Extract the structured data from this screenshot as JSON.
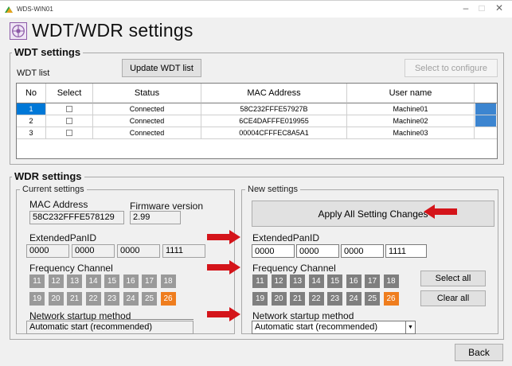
{
  "window": {
    "title": "WDS-WIN01",
    "controls": [
      "–",
      "□",
      "✕"
    ]
  },
  "header": {
    "title": "WDT/WDR settings",
    "icon": "network-settings-icon"
  },
  "wdt": {
    "group_label": "WDT settings",
    "list_label": "WDT list",
    "update_button": "Update WDT list",
    "select_button": "Select to configure",
    "columns": [
      "No",
      "Select",
      "Status",
      "MAC Address",
      "User name"
    ],
    "rows": [
      {
        "no": "1",
        "status": "Connected",
        "mac": "58C232FFFE57927B",
        "user": "Machine01",
        "selected": true
      },
      {
        "no": "2",
        "status": "Connected",
        "mac": "6CE4DAFFFE019955",
        "user": "Machine02",
        "selected": false
      },
      {
        "no": "3",
        "status": "Connected",
        "mac": "00004CFFFEC8A5A1",
        "user": "Machine03",
        "selected": false
      }
    ]
  },
  "wdr": {
    "group_label": "WDR settings",
    "current": {
      "label": "Current settings",
      "mac_label": "MAC Address",
      "mac_value": "58C232FFFE578129",
      "fw_label": "Firmware version",
      "fw_value": "2.99",
      "pan_label": "ExtendedPanID",
      "pan_values": [
        "0000",
        "0000",
        "0000",
        "1111"
      ],
      "freq_label": "Frequency Channel",
      "channels": [
        "11",
        "12",
        "13",
        "14",
        "15",
        "16",
        "17",
        "18",
        "19",
        "20",
        "21",
        "22",
        "23",
        "24",
        "25",
        "26"
      ],
      "highlight_channel": "26",
      "startup_label": "Network startup method",
      "startup_value": "Automatic start (recommended)"
    },
    "new": {
      "label": "New settings",
      "apply_button": "Apply All Setting Changes",
      "pan_label": "ExtendedPanID",
      "pan_values": [
        "0000",
        "0000",
        "0000",
        "1111"
      ],
      "freq_label": "Frequency Channel",
      "channels": [
        "11",
        "12",
        "13",
        "14",
        "15",
        "16",
        "17",
        "18",
        "19",
        "20",
        "21",
        "22",
        "23",
        "24",
        "25",
        "26"
      ],
      "highlight_channel": "26",
      "select_all_button": "Select all",
      "clear_all_button": "Clear all",
      "startup_label": "Network startup method",
      "startup_value": "Automatic start (recommended)"
    }
  },
  "footer": {
    "back_button": "Back"
  },
  "colors": {
    "selected_row": "#0078d7",
    "highlight_channel": "#ef7d1e",
    "arrow": "#d4141a"
  }
}
